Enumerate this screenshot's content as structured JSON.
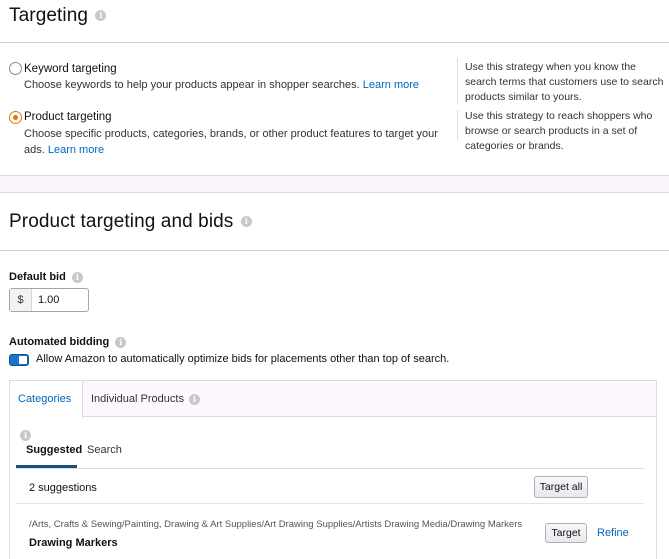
{
  "targeting": {
    "title": "Targeting",
    "options": [
      {
        "title": "Keyword targeting",
        "description": "Choose keywords to help your products appear in shopper searches.",
        "link": "Learn more",
        "note": "Use this strategy when you know the search terms that customers use to search products similar to yours.",
        "selected": false
      },
      {
        "title": "Product targeting",
        "description": "Choose specific products, categories, brands, or other product features to target your ads.",
        "link": "Learn more",
        "note": "Use this strategy to reach shoppers who browse or search products in a set of categories or brands.",
        "selected": true
      }
    ]
  },
  "product_targeting": {
    "title": "Product targeting and bids",
    "default_bid": {
      "label": "Default bid",
      "currency": "$",
      "value": "1.00"
    },
    "automated_bidding": {
      "label": "Automated bidding",
      "toggle_text": "Allow Amazon to automatically optimize bids for placements other than top of search.",
      "enabled": true
    },
    "tabs": [
      {
        "label": "Categories",
        "active": true
      },
      {
        "label": "Individual Products",
        "active": false
      }
    ],
    "subtabs": [
      {
        "label": "Suggested",
        "active": true
      },
      {
        "label": "Search",
        "active": false
      }
    ],
    "suggestions_count": "2 suggestions",
    "target_all_label": "Target all",
    "suggestions": [
      {
        "path": "/Arts, Crafts & Sewing/Painting, Drawing & Art Supplies/Art Drawing Supplies/Artists Drawing Media/Drawing Markers",
        "name": "Drawing Markers",
        "target_label": "Target",
        "refine_label": "Refine"
      }
    ]
  },
  "colors": {
    "accent_orange": "#e77600",
    "link_blue": "#0066c0",
    "toggle_blue": "#1a73c9",
    "section_band": "#fbf6fb"
  }
}
